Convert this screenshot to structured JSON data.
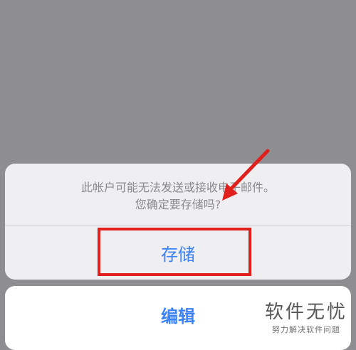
{
  "alert": {
    "message_line1": "此帐户可能无法发送或接收电子邮件。",
    "message_line2": "您确定要存储吗?"
  },
  "actions": {
    "save_label": "存储",
    "edit_label": "编辑"
  },
  "watermark": {
    "title": "软件无忧",
    "subtitle": "努力解决软件问题"
  },
  "colors": {
    "accent_blue": "#3b82f6",
    "highlight_red": "#e0201c",
    "backdrop_gray": "#8e8e90"
  }
}
